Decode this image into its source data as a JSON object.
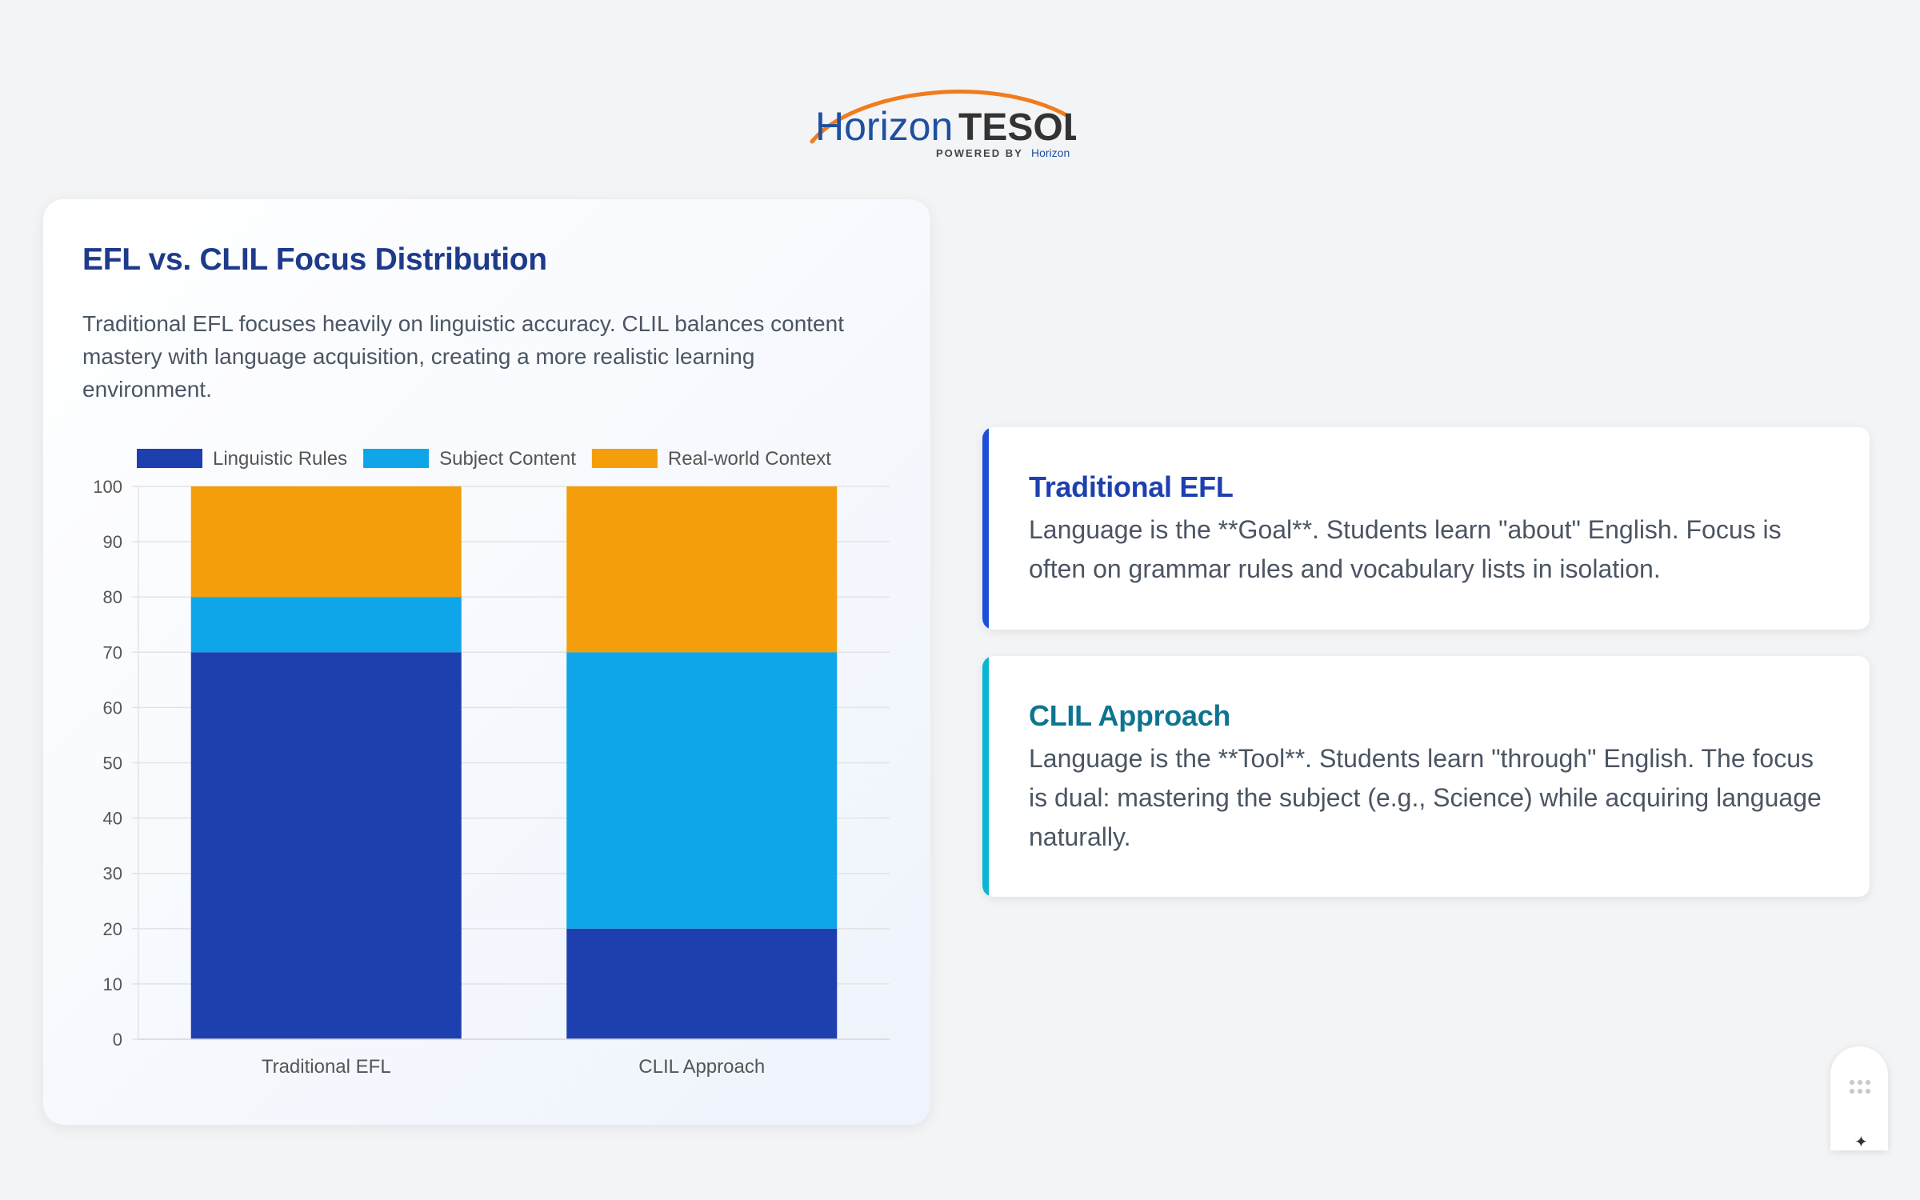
{
  "logo": {
    "word1": "Horizon",
    "word2": "TESOL",
    "tagline": "POWERED BY",
    "tagline_brand": "Horizon",
    "colors": {
      "blue": "#1e4fa0",
      "dark": "#333333",
      "orange": "#f07c1e"
    }
  },
  "chart_card": {
    "title": "EFL vs. CLIL Focus Distribution",
    "description": "Traditional EFL focuses heavily on linguistic accuracy. CLIL balances content mastery with language acquisition, creating a more realistic learning environment."
  },
  "chart_data": {
    "type": "bar",
    "stacked": true,
    "categories": [
      "Traditional EFL",
      "CLIL Approach"
    ],
    "series": [
      {
        "name": "Linguistic Rules",
        "values": [
          70,
          20
        ],
        "color": "#1e40af"
      },
      {
        "name": "Subject Content",
        "values": [
          10,
          50
        ],
        "color": "#0ea5e9"
      },
      {
        "name": "Real-world Context",
        "values": [
          20,
          30
        ],
        "color": "#f59e0b"
      }
    ],
    "ylim": [
      0,
      100
    ],
    "yticks": [
      0,
      10,
      20,
      30,
      40,
      50,
      60,
      70,
      80,
      90,
      100
    ],
    "grid": true,
    "legend_position": "top"
  },
  "cards": [
    {
      "title": "Traditional EFL",
      "text": "Language is the **Goal**. Students learn \"about\" English. Focus is often on grammar rules and vocabulary lists in isolation.",
      "accent": "#1d4ed8",
      "title_color": "#1e40af"
    },
    {
      "title": "CLIL Approach",
      "text": "Language is the **Tool**. Students learn \"through\" English. The focus is dual: mastering the subject (e.g., Science) while acquiring language naturally.",
      "accent": "#06b6d4",
      "title_color": "#0e7490"
    }
  ],
  "widget": {
    "icons": [
      "drag-handle-icon",
      "sparkle-icon"
    ],
    "sparkle_glyph": "✦"
  }
}
